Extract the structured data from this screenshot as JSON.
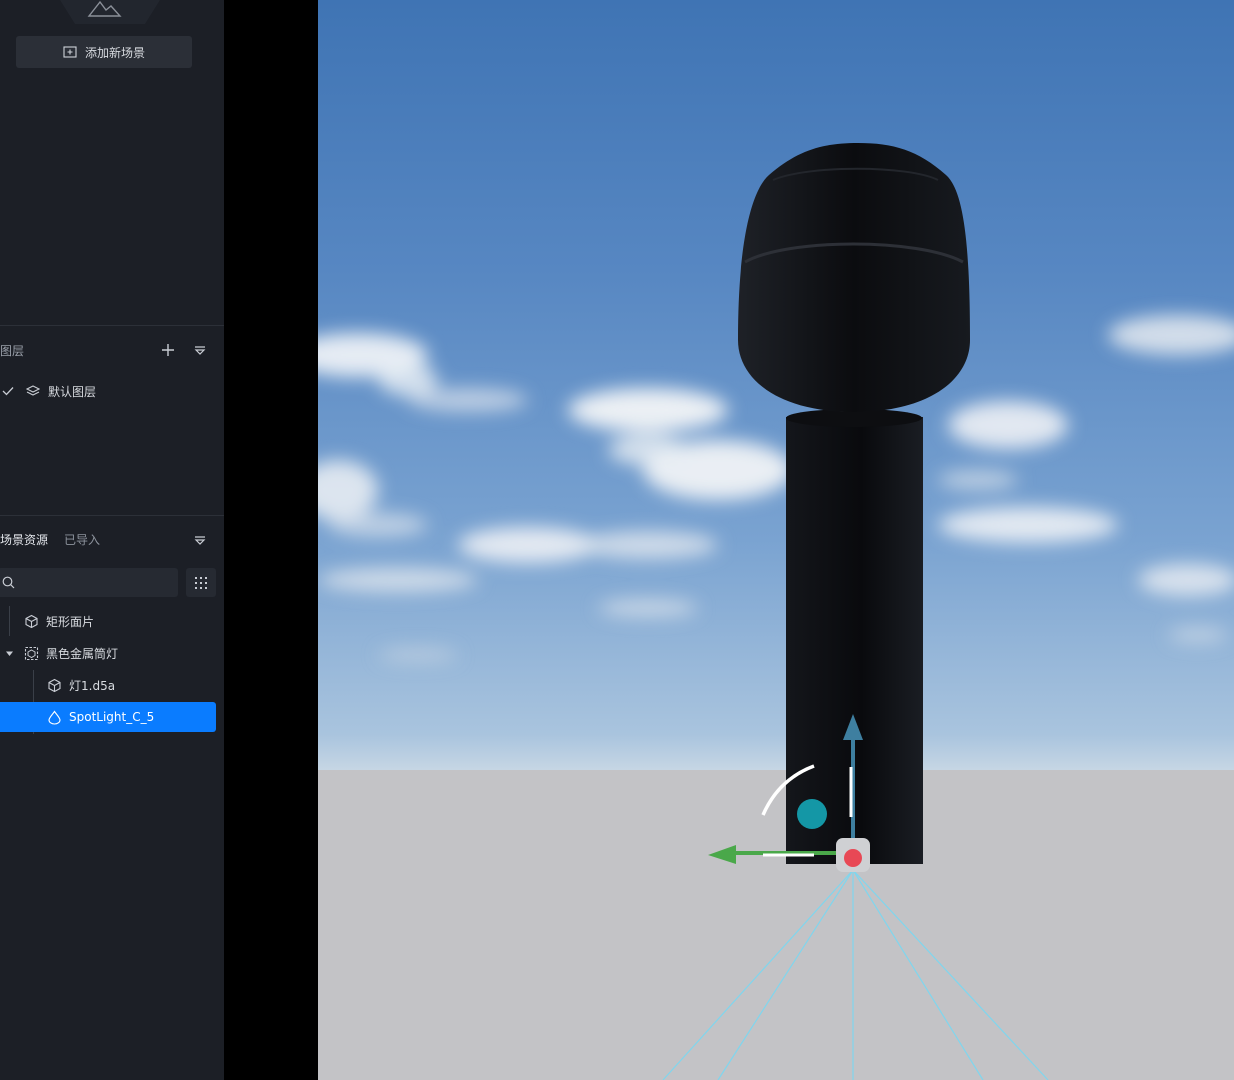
{
  "sidebar": {
    "add_scene_label": "添加新场景",
    "layers": {
      "title": "图层",
      "items": [
        {
          "label": "默认图层",
          "checked": true
        }
      ]
    },
    "assets": {
      "tab_active": "场景资源",
      "tab_inactive": "已导入",
      "search_placeholder": "",
      "tree": [
        {
          "label": "矩形面片",
          "icon": "cube-icon"
        },
        {
          "label": "黑色金属筒灯",
          "icon": "group-icon",
          "expanded": true
        },
        {
          "label": "灯1.d5a",
          "icon": "cube-icon"
        },
        {
          "label": "SpotLight_C_5",
          "icon": "spotlight-icon",
          "selected": true
        }
      ]
    }
  },
  "colors": {
    "sidebar_bg": "#1c1f26",
    "selection": "#0a7cff",
    "gizmo_y_axis": "#3e7fa0",
    "gizmo_x_axis": "#4aa84a",
    "gizmo_center": "#e84855",
    "gizmo_rotate_handle": "#1497a6",
    "light_cone": "#7fd6ee"
  }
}
